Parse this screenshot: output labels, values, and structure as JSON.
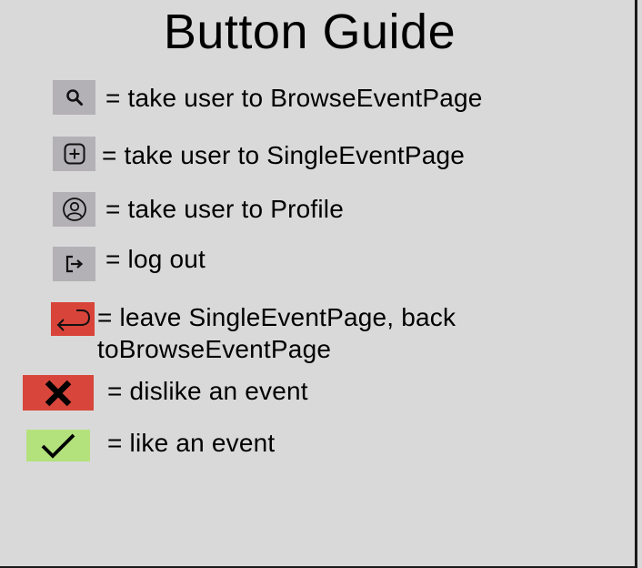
{
  "title": "Button Guide",
  "colors": {
    "background": "#d9d9d9",
    "icon_chip_gray": "#b3b0b6",
    "dislike_red": "#d8463b",
    "back_red": "#d9443a",
    "like_green": "#b3e27c"
  },
  "legend": [
    {
      "icon": "search-icon",
      "text": "= take user to BrowseEventPage"
    },
    {
      "icon": "add-box-icon",
      "text": "= take user to SingleEventPage"
    },
    {
      "icon": "profile-icon",
      "text": "= take user to Profile"
    },
    {
      "icon": "logout-icon",
      "text": "= log out"
    },
    {
      "icon": "return-arrow-icon",
      "text_line1": "= leave SingleEventPage, back",
      "text_line2": "toBrowseEventPage"
    },
    {
      "icon": "close-x-icon",
      "text": "= dislike an event"
    },
    {
      "icon": "checkmark-icon",
      "text": "= like an event"
    }
  ]
}
